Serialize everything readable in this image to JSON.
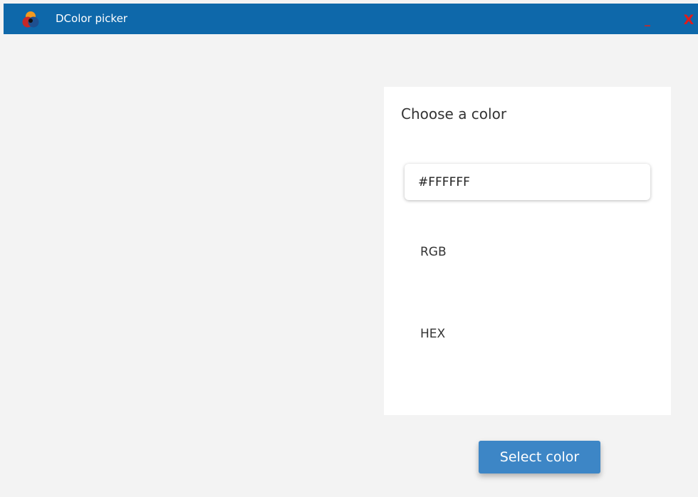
{
  "window": {
    "title": "DColor picker",
    "minimize_label": "_",
    "close_label": "X",
    "titlebar_color": "#0e68aa",
    "logo_icon": "color-palette-icon"
  },
  "picker": {
    "heading": "Choose a color",
    "hex_value": "#FFFFFF",
    "rgb_label": "RGB",
    "hex_label": "HEX"
  },
  "actions": {
    "select_label": "Select color",
    "button_color": "#3d86c6"
  }
}
